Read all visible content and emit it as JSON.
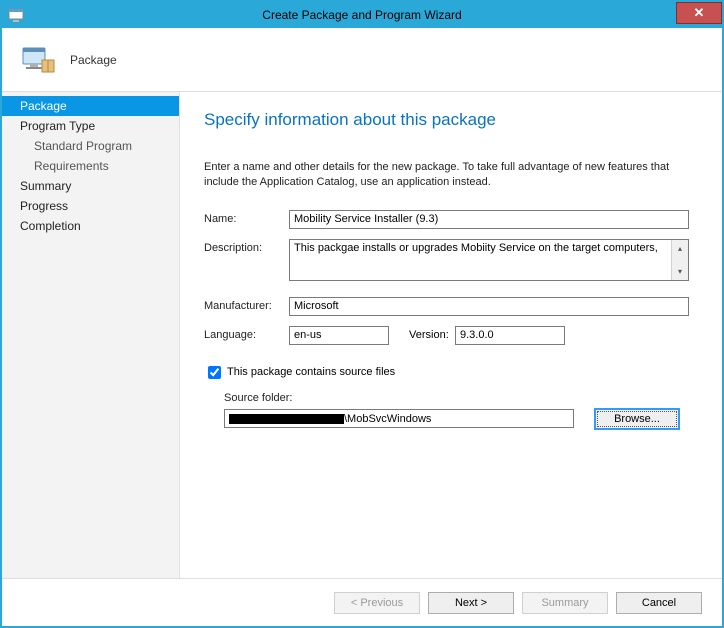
{
  "titlebar": {
    "title": "Create Package and Program Wizard"
  },
  "header": {
    "title": "Package"
  },
  "sidebar": {
    "items": [
      {
        "label": "Package",
        "selected": true,
        "sub": false
      },
      {
        "label": "Program Type",
        "selected": false,
        "sub": false
      },
      {
        "label": "Standard Program",
        "selected": false,
        "sub": true
      },
      {
        "label": "Requirements",
        "selected": false,
        "sub": true
      },
      {
        "label": "Summary",
        "selected": false,
        "sub": false
      },
      {
        "label": "Progress",
        "selected": false,
        "sub": false
      },
      {
        "label": "Completion",
        "selected": false,
        "sub": false
      }
    ]
  },
  "content": {
    "title": "Specify information about this package",
    "instruction": "Enter a name and other details for the new package. To take full advantage of new features that include the Application Catalog, use an application instead.",
    "labels": {
      "name": "Name:",
      "description": "Description:",
      "manufacturer": "Manufacturer:",
      "language": "Language:",
      "version": "Version:",
      "sourceFilesCheckbox": "This package contains source files",
      "sourceFolder": "Source folder:"
    },
    "values": {
      "name": "Mobility Service Installer (9.3)",
      "description": "This packgae installs or upgrades Mobiity Service on the target computers,",
      "manufacturer": "Microsoft",
      "language": "en-us",
      "version": "9.3.0.0",
      "sourceFilesChecked": true,
      "sourceFolderSuffix": "\\MobSvcWindows"
    },
    "buttons": {
      "browse": "Browse..."
    }
  },
  "footer": {
    "previous": "< Previous",
    "next": "Next >",
    "summary": "Summary",
    "cancel": "Cancel"
  }
}
